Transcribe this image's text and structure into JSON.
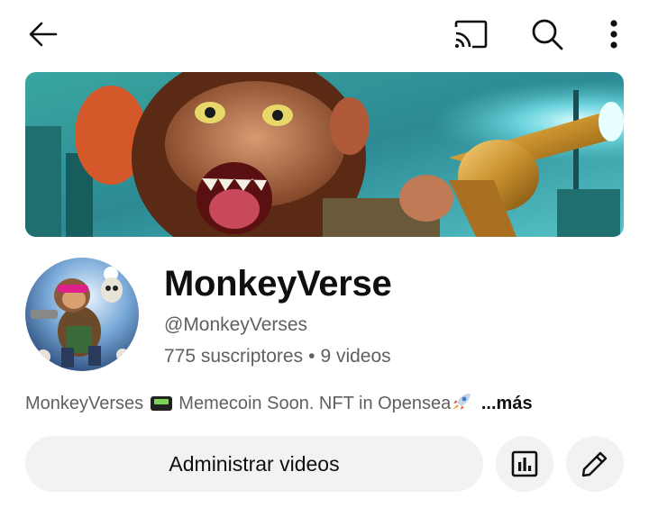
{
  "topbar": {
    "back_icon": "arrow-left-icon",
    "cast_icon": "cast-icon",
    "search_icon": "search-icon",
    "more_icon": "more-vertical-icon"
  },
  "channel": {
    "name": "MonkeyVerse",
    "handle": "@MonkeyVerses",
    "subscribers": "775 suscriptores",
    "separator": "•",
    "videos": "9 videos",
    "description": "MonkeyVerses",
    "description_rest": "Memecoin Soon. NFT in Opensea",
    "more_label": "...más"
  },
  "actions": {
    "manage_label": "Administrar videos",
    "analytics_icon": "analytics-icon",
    "edit_icon": "pencil-icon"
  },
  "colors": {
    "text_primary": "#0f0f0f",
    "text_secondary": "#606060",
    "button_bg": "#f2f2f2"
  }
}
